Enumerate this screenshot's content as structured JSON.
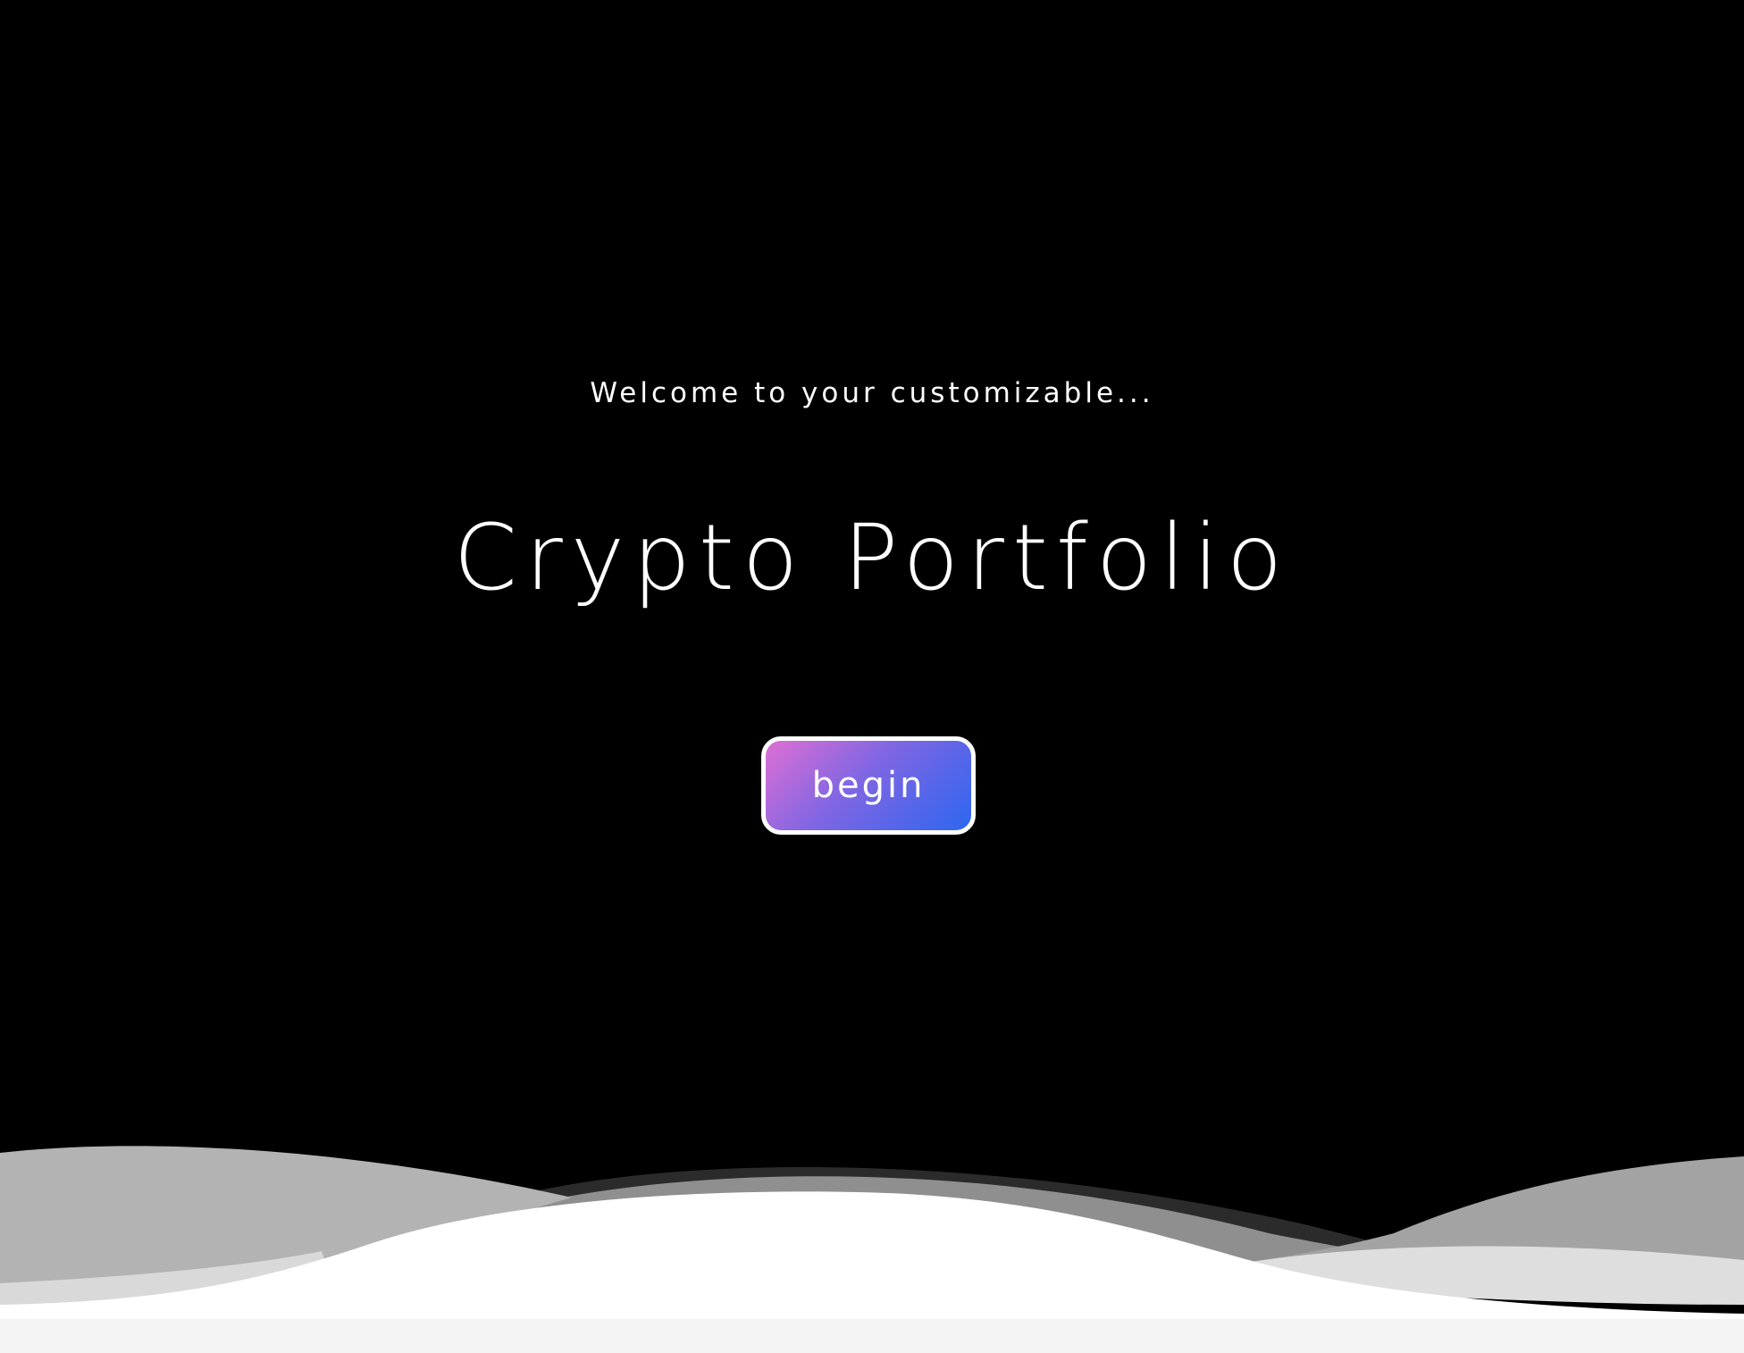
{
  "hero": {
    "subtitle": "Welcome to your customizable...",
    "title": "Crypto Portfolio",
    "begin_label": "begin"
  },
  "colors": {
    "background": "#000000",
    "text": "#ffffff",
    "button_gradient_start": "#de6fd4",
    "button_gradient_end": "#2d67f0",
    "button_border": "#ffffff"
  }
}
